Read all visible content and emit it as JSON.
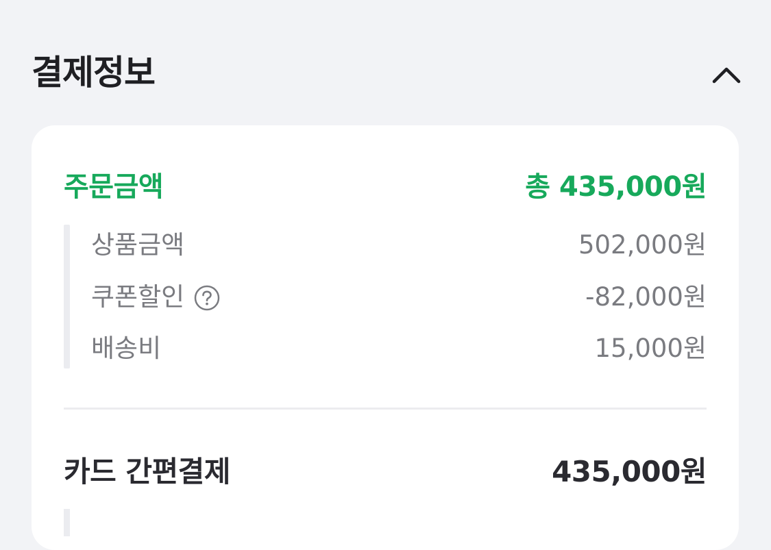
{
  "section": {
    "title": "결제정보",
    "toggle_icon": "chevron-up-icon"
  },
  "order": {
    "label": "주문금액",
    "total": "총 435,000원",
    "accent_color": "#17a95b",
    "details": [
      {
        "label": "상품금액",
        "value": "502,000원"
      },
      {
        "label": "쿠폰할인",
        "value": "-82,000원",
        "help_icon": "question-circle-icon"
      },
      {
        "label": "배송비",
        "value": "15,000원"
      }
    ]
  },
  "payment": {
    "label": "카드 간편결제",
    "value": "435,000원"
  }
}
